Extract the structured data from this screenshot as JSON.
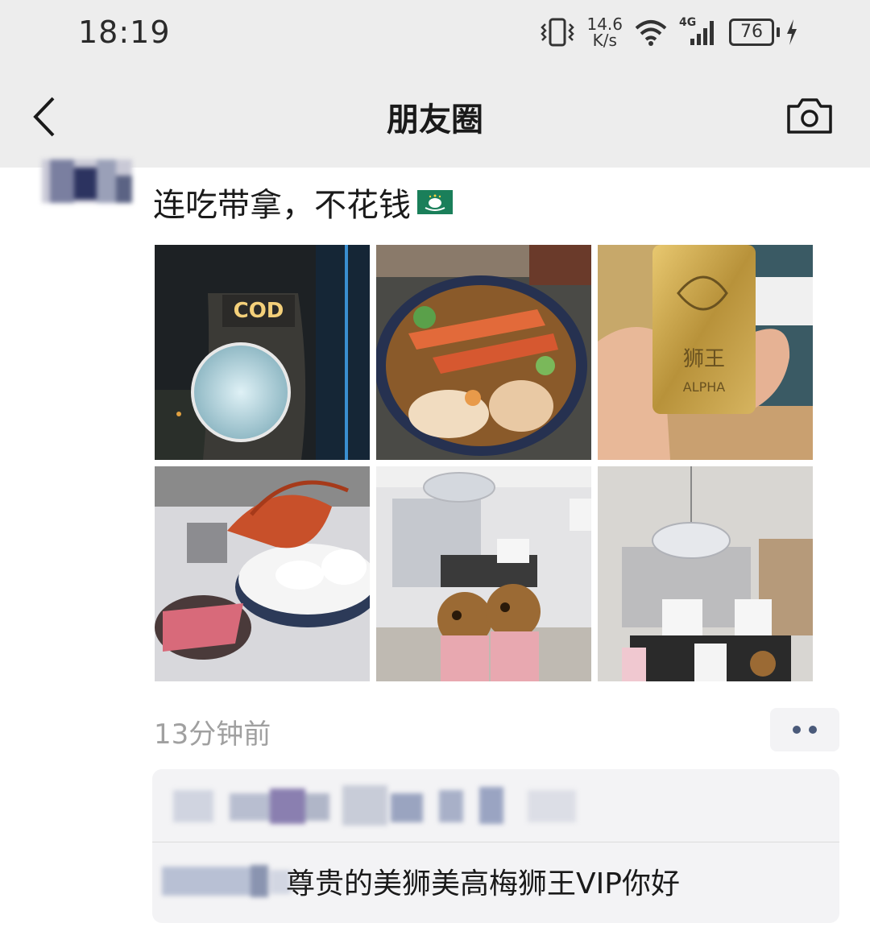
{
  "status_bar": {
    "time": "18:19",
    "net_speed_value": "14.6",
    "net_speed_unit": "K/s",
    "network": "4G",
    "battery": "76"
  },
  "nav": {
    "title": "朋友圈",
    "back_icon": "chevron-left-icon",
    "camera_icon": "camera-icon"
  },
  "post": {
    "text": "连吃带拿，不花钱",
    "flag_icon": "macau-flag-icon",
    "photos": [
      {
        "name": "photo-building-sign",
        "sign": "COD"
      },
      {
        "name": "photo-seafood-hotpot"
      },
      {
        "name": "photo-gold-card",
        "card_text_1": "狮王",
        "card_text_2": "ALPHA"
      },
      {
        "name": "photo-lobster-platter"
      },
      {
        "name": "photo-private-room-lions"
      },
      {
        "name": "photo-private-room-gifts"
      }
    ],
    "timestamp": "13分钟前"
  },
  "comments": {
    "comment_text": "尊贵的美狮美高梅狮王VIP你好"
  },
  "colors": {
    "header_bg": "#ededed",
    "comment_bg": "#f3f3f5",
    "link_blue": "#4a5a7a",
    "timestamp_gray": "#a0a0a0"
  }
}
